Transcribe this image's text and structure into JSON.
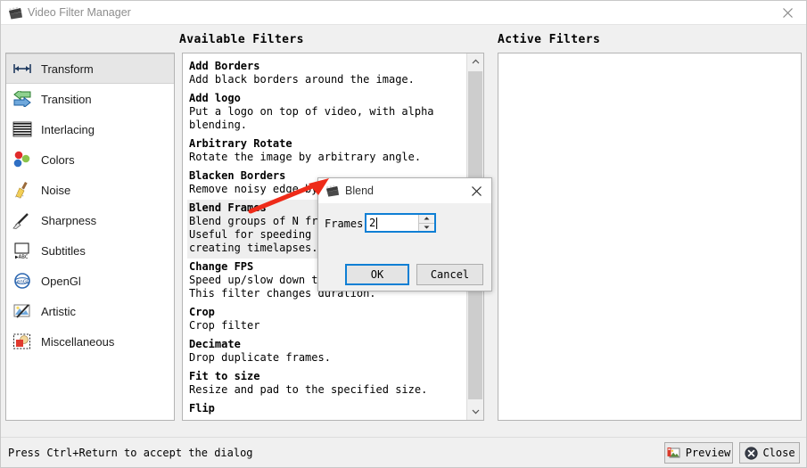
{
  "window": {
    "title": "Video Filter Manager",
    "icon": "clapperboard-icon",
    "close_label": "×"
  },
  "headings": {
    "available": "Available Filters",
    "active": "Active Filters"
  },
  "sidebar": {
    "items": [
      {
        "label": "Transform",
        "icon": "transform-icon",
        "selected": true
      },
      {
        "label": "Transition",
        "icon": "transition-icon",
        "selected": false
      },
      {
        "label": "Interlacing",
        "icon": "interlacing-icon",
        "selected": false
      },
      {
        "label": "Colors",
        "icon": "colors-icon",
        "selected": false
      },
      {
        "label": "Noise",
        "icon": "noise-icon",
        "selected": false
      },
      {
        "label": "Sharpness",
        "icon": "sharpness-icon",
        "selected": false
      },
      {
        "label": "Subtitles",
        "icon": "subtitles-icon",
        "selected": false
      },
      {
        "label": "OpenGl",
        "icon": "opengl-icon",
        "selected": false
      },
      {
        "label": "Artistic",
        "icon": "artistic-icon",
        "selected": false
      },
      {
        "label": "Miscellaneous",
        "icon": "miscellaneous-icon",
        "selected": false
      }
    ]
  },
  "available_filters": [
    {
      "name": "Add Borders",
      "desc": "Add black borders around the image.",
      "selected": false
    },
    {
      "name": "Add logo",
      "desc": "Put a logo on top of video, with alpha blending.",
      "selected": false
    },
    {
      "name": "Arbitrary Rotate",
      "desc": "Rotate the image by arbitrary angle.",
      "selected": false
    },
    {
      "name": "Blacken Borders",
      "desc": "Remove noisy edge by turning them black.",
      "selected": false
    },
    {
      "name": "Blend Frames",
      "desc": "Blend groups of N frames together.\nUseful for speeding up source video and\ncreating timelapses.",
      "selected": true
    },
    {
      "name": "Change FPS",
      "desc": "Speed up/slow down the video.\nThis filter changes duration.",
      "selected": false
    },
    {
      "name": "Crop",
      "desc": "Crop filter",
      "selected": false
    },
    {
      "name": "Decimate",
      "desc": "Drop duplicate frames.",
      "selected": false
    },
    {
      "name": "Fit to size",
      "desc": "Resize and pad to the specified size.",
      "selected": false
    },
    {
      "name": "Flip",
      "desc": "",
      "selected": false
    }
  ],
  "active_filters": [],
  "scrollbar": {
    "up_arrow": "⌃",
    "down_arrow": "⌄"
  },
  "dialog": {
    "title": "Blend",
    "icon": "clapperboard-icon",
    "close_label": "×",
    "frames_label": "Frames",
    "frames_value": "2",
    "ok_label": "OK",
    "cancel_label": "Cancel"
  },
  "statusbar": {
    "text": "Press Ctrl+Return to accept the dialog"
  },
  "footer_buttons": {
    "preview_label": "Preview",
    "preview_icon": "image-preview-icon",
    "close_label": "Close",
    "close_icon": "close-circle-icon"
  },
  "annotation": {
    "type": "red-arrow",
    "color": "#ee2b19"
  },
  "colors": {
    "focus_blue": "#0f7fd4",
    "window_bg": "#f0f0f0",
    "panel_bg": "#ffffff",
    "selection_gray": "#e6e6e6",
    "annotation_red": "#ee2b19"
  }
}
